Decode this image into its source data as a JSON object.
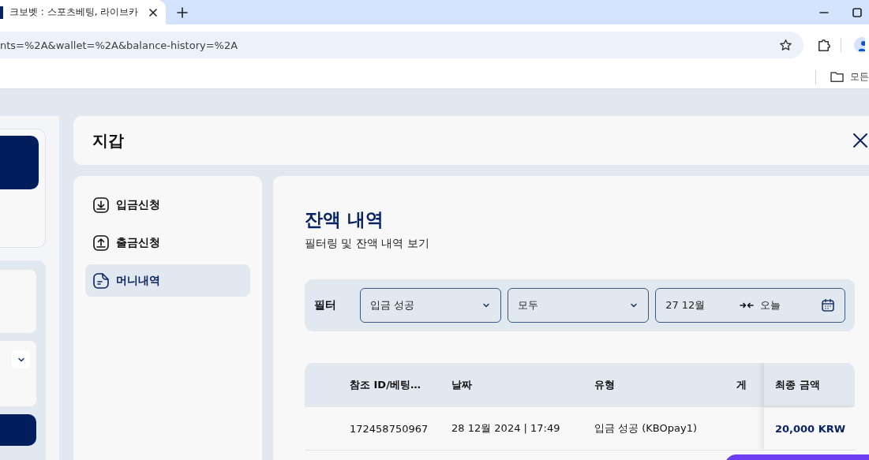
{
  "browser": {
    "tab": {
      "title": "크보벳 : 스포츠베팅, 라이브카",
      "selected": true
    },
    "url": "nts=%2A&wallet=%2A&balance-history=%2A",
    "bookmarks_label": "모든"
  },
  "wallet": {
    "title": "지갑",
    "menu": [
      {
        "label": "입금신청",
        "kind": "deposit",
        "selected": false
      },
      {
        "label": "출금신청",
        "kind": "withdraw",
        "selected": false
      },
      {
        "label": "머니내역",
        "kind": "history",
        "selected": true
      }
    ],
    "content": {
      "title": "잔액 내역",
      "subtitle": "필터링 및 잔액 내역 보기",
      "filter": {
        "label": "필터",
        "selects": [
          {
            "value": "입금 성공"
          },
          {
            "value": "모두"
          }
        ],
        "date_from": "27 12월",
        "date_to": "오늘"
      },
      "table": {
        "columns": [
          "참조 ID/베팅…",
          "날짜",
          "유형",
          "게",
          "최종 금액"
        ],
        "rows": [
          [
            "172458750967",
            "28 12월 2024 | 17:49",
            "입금 성공 (KBOpay1)",
            "",
            "20,000 KRW"
          ]
        ]
      }
    }
  }
}
